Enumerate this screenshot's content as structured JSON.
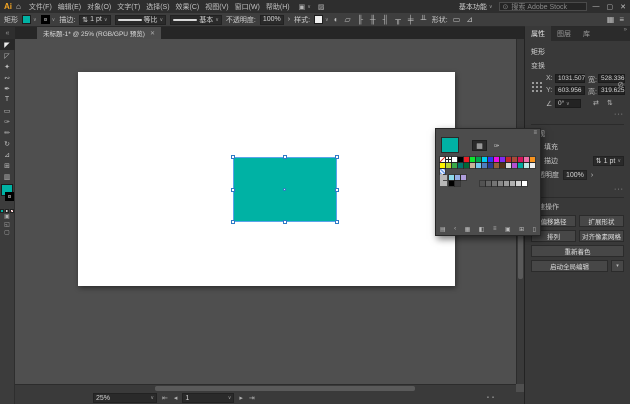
{
  "titlebar": {
    "logo": "Ai",
    "home_icon": "⌂",
    "menus": [
      {
        "label": "文件(F)"
      },
      {
        "label": "编辑(E)"
      },
      {
        "label": "对象(O)"
      },
      {
        "label": "文字(T)"
      },
      {
        "label": "选择(S)"
      },
      {
        "label": "效果(C)"
      },
      {
        "label": "视图(V)"
      },
      {
        "label": "窗口(W)"
      },
      {
        "label": "帮助(H)"
      }
    ],
    "arrange_icon": "▣",
    "arrange_caret": "∨",
    "share_icon": "▨",
    "workspace_label": "基本功能",
    "workspace_caret": "∨",
    "search_icon": "⊙",
    "search_placeholder": "搜索 Adobe Stock",
    "minimize": "—",
    "maximize": "▢",
    "close": "✕"
  },
  "controlbar": {
    "selection_label": "矩形",
    "fill_color": "#00b2a4",
    "caret": "∨",
    "stroke_label": "描边:",
    "stepper_icon": "⇅",
    "stroke_weight": "1 pt",
    "profile_label": "等比",
    "brush_label": "基本",
    "opacity_label": "不透明度:",
    "opacity_value": "100%",
    "opacity_more": "›",
    "style_label": "样式:",
    "style_color": "#f0f0f0",
    "doc_setup_icon": "◐",
    "doc_icon": "▱",
    "align_icons": [
      {
        "name": "align-h-left-icon",
        "glyph": "╟"
      },
      {
        "name": "align-h-center-icon",
        "glyph": "╫"
      },
      {
        "name": "align-h-right-icon",
        "glyph": "╢"
      },
      {
        "name": "align-v-top-icon",
        "glyph": "╥"
      },
      {
        "name": "align-v-middle-icon",
        "glyph": "╪"
      },
      {
        "name": "align-v-bottom-icon",
        "glyph": "╨"
      }
    ],
    "shape_label": "形状:",
    "shape_icon_1": "▭",
    "shape_icon_2": "⊿",
    "panel_icon_1": "▦",
    "panel_icon_2": "≡"
  },
  "tabbar": {
    "collapse_icon": "«",
    "tab_title": "未标题-1* @ 25% (RGB/GPU 预览)",
    "tab_close": "✕"
  },
  "toolbar": {
    "tools": [
      {
        "name": "selection-tool",
        "glyph": "◤"
      },
      {
        "name": "direct-selection-tool",
        "glyph": "◸"
      },
      {
        "name": "magic-wand-tool",
        "glyph": "✦"
      },
      {
        "name": "lasso-tool",
        "glyph": "∾"
      },
      {
        "name": "pen-tool",
        "glyph": "✒"
      },
      {
        "name": "type-tool",
        "glyph": "T"
      },
      {
        "name": "rectangle-tool",
        "glyph": "▭"
      },
      {
        "name": "paintbrush-tool",
        "glyph": "✑"
      },
      {
        "name": "pencil-tool",
        "glyph": "✏"
      },
      {
        "name": "rotate-tool",
        "glyph": "↻"
      },
      {
        "name": "scale-tool",
        "glyph": "⊿"
      },
      {
        "name": "mesh-tool",
        "glyph": "⊞"
      },
      {
        "name": "gradient-tool",
        "glyph": "▥"
      }
    ],
    "fill_color": "#00b2a4",
    "color_mode_color": "#00b2a4",
    "gradient_icon": "▥",
    "none_icon": "⊘",
    "draw_mode_icon_1": "▣",
    "draw_mode_icon_2": "◱",
    "screen_mode_icon": "▢"
  },
  "canvas": {
    "rect_color": "#00b2a4"
  },
  "swatches_popup": {
    "preview_color": "#00b2a4",
    "swatches_view_icon": "▦",
    "mixer_view_icon": "✑",
    "menu_icon": "≡",
    "row1": [
      "linear-gradient(135deg,#fff 42%,#e23b2e 42%,#e23b2e 58%,#fff 58%)",
      "linear-gradient(0deg,transparent 42%,#222 42%,#222 58%,transparent 58%),linear-gradient(90deg,transparent 42%,#222 42%,#222 58%,transparent 58%),#fff",
      "#ffffff",
      "#000000",
      "#ed1c24",
      "#0ee62f",
      "#00a44a",
      "#00cdf2",
      "#2b3cf2",
      "#f20ce8",
      "#7f2bf2",
      "#c1272d",
      "#a84a38",
      "#d4145a",
      "#ef6ea8",
      "#f7931e"
    ],
    "row2": [
      "#fff200",
      "#b6d433",
      "#3aa948",
      "#00746b",
      "#006837",
      "#c7b299",
      "#76c5ef",
      "#4f7dbe",
      "#273c8f",
      "#936037",
      "#54301a",
      "#d8d8d8",
      "#b44fd0",
      "#00a99d",
      "#bfe8e4",
      "#f0f0f0"
    ],
    "pattern_swatch": "repeating-linear-gradient(45deg,#6f9fe8 0 1.5px,#e8f0ff 1.5px 3px)",
    "pastel_row": [
      "#8ed8ea",
      "#96aee6",
      "#b09edc"
    ],
    "gray_group": [
      "#000000",
      "#3f3f41"
    ],
    "gray_ramp": [
      "#525252",
      "#636363",
      "#747474",
      "#878787",
      "#9b9b9b",
      "#b0b0b0",
      "#d2d2d2",
      "#ffffff"
    ],
    "footer_icons": [
      {
        "name": "swatch-libraries-icon",
        "glyph": "▤"
      },
      {
        "name": "previous-library-icon",
        "glyph": "‹"
      },
      {
        "name": "add-to-library-icon",
        "glyph": "▦"
      },
      {
        "name": "swatch-kinds-icon",
        "glyph": "◧"
      },
      {
        "name": "swatch-options-icon",
        "glyph": "≡"
      },
      {
        "name": "new-color-group-icon",
        "glyph": "▣"
      },
      {
        "name": "new-swatch-icon",
        "glyph": "⊞"
      },
      {
        "name": "delete-swatch-icon",
        "glyph": "▯"
      }
    ]
  },
  "properties": {
    "tabs": [
      {
        "label": "属性"
      },
      {
        "label": "图层"
      },
      {
        "label": "库"
      }
    ],
    "collapse_icon": "»",
    "object_type": "矩形",
    "transform": {
      "section_label": "变换",
      "x_label": "X:",
      "x_value": "1031.507",
      "y_label": "Y:",
      "y_value": "603.956",
      "w_label": "宽:",
      "w_value": "528.336",
      "h_label": "高:",
      "h_value": "319.625",
      "angle_icon": "∠",
      "angle_value": "0°",
      "caret": "∨",
      "constrain_icon": "⊘",
      "flip_h_icon": "⇄",
      "flip_v_icon": "⇅",
      "more_label": "···"
    },
    "appearance": {
      "section_label": "外观",
      "fill_label": "填充",
      "fill_color": "#e800c9",
      "stroke_label": "描边",
      "stepper_icon": "⇅",
      "stroke_weight": "1 pt",
      "caret": "∨",
      "opacity_label": "不透明度",
      "opacity_value": "100%",
      "opacity_more": "›",
      "more_label": "···"
    },
    "quick_actions": {
      "section_label": "快速操作",
      "buttons": [
        {
          "label": "偏移路径"
        },
        {
          "label": "扩展形状"
        },
        {
          "label": "排列"
        },
        {
          "label": "对齐像素网格"
        }
      ],
      "recolor_label": "重新着色",
      "global_edit_label": "启动全局编辑",
      "global_edit_caret": "▾"
    }
  },
  "statusbar": {
    "zoom_value": "25%",
    "caret": "∨",
    "first_icon": "⇤",
    "prev_icon": "◂",
    "artboard_value": "1",
    "next_icon": "▸",
    "last_icon": "⇥",
    "misc_icon_1": "▪",
    "misc_icon_2": "▪"
  }
}
